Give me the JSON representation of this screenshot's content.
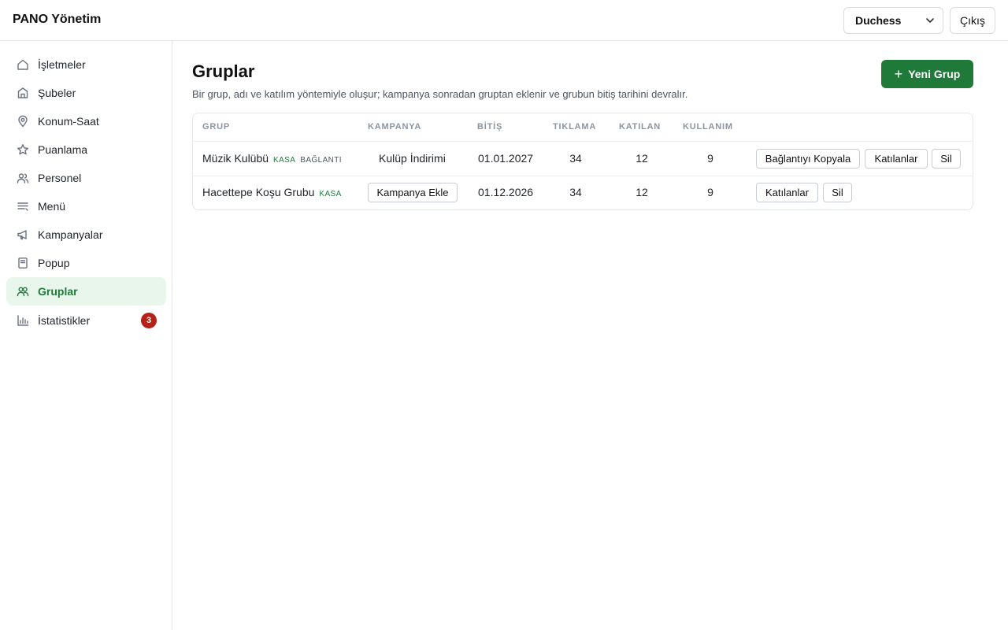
{
  "app": {
    "title": "PANO Yönetim"
  },
  "header": {
    "tenant": "Duchess",
    "logout_label": "Çıkış"
  },
  "sidebar": {
    "items": [
      {
        "label": "İşletmeler",
        "icon": "home-icon"
      },
      {
        "label": "Şubeler",
        "icon": "store-icon"
      },
      {
        "label": "Konum-Saat",
        "icon": "map-pin-icon"
      },
      {
        "label": "Puanlama",
        "icon": "star-icon"
      },
      {
        "label": "Personel",
        "icon": "users-icon"
      },
      {
        "label": "Menü",
        "icon": "list-icon"
      },
      {
        "label": "Kampanyalar",
        "icon": "megaphone-icon"
      },
      {
        "label": "Popup",
        "icon": "document-icon"
      },
      {
        "label": "Gruplar",
        "icon": "group-icon",
        "active": true
      },
      {
        "label": "İstatistikler",
        "icon": "bar-chart-icon",
        "badge": "3"
      }
    ]
  },
  "main": {
    "title": "Gruplar",
    "description": "Bir grup, adı ve katılım yöntemiyle oluşur; kampanya sonradan gruptan eklenir ve grubun bitiş tarihini devralır.",
    "new_button_label": "Yeni Grup",
    "table": {
      "headers": [
        "GRUP",
        "KAMPANYA",
        "BİTİŞ",
        "TIKLAMA",
        "KATILAN",
        "KULLANIM"
      ],
      "rows": [
        {
          "name": "Müzik Kulübü",
          "tags": [
            "KASA",
            "BAĞLANTI"
          ],
          "campaign": "Kulüp İndirimi",
          "end_date": "01.01.2027",
          "clicks": "34",
          "joined": "12",
          "usage": "9",
          "actions": [
            "Bağlantıyı Kopyala",
            "Katılanlar",
            "Sil"
          ]
        },
        {
          "name": "Hacettepe Koşu Grubu",
          "tags": [
            "KASA"
          ],
          "campaign_button": "Kampanya Ekle",
          "end_date": "01.12.2026",
          "clicks": "34",
          "joined": "12",
          "usage": "9",
          "actions": [
            "Katılanlar",
            "Sil"
          ]
        }
      ]
    }
  },
  "colors": {
    "accent": "#1f7a3a",
    "active_bg": "#e9f6ec",
    "badge": "#b42318"
  }
}
